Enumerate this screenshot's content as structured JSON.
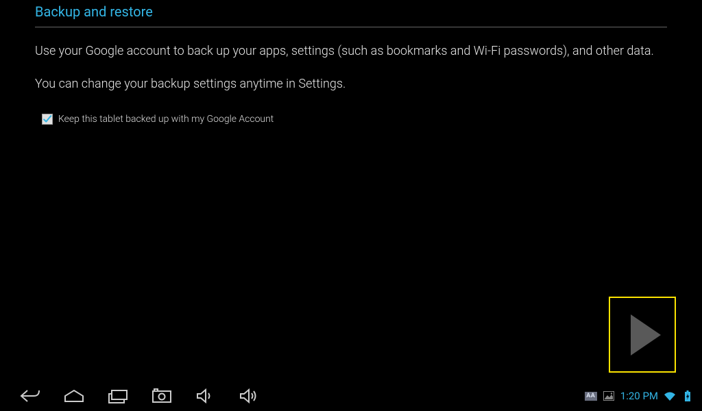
{
  "title": "Backup and restore",
  "description": {
    "line1": "Use your Google account to back up your apps, settings (such as bookmarks and Wi-Fi passwords), and other data.",
    "line2": "You can change your backup settings anytime in Settings."
  },
  "checkbox": {
    "label": "Keep this tablet backed up with my Google Account",
    "checked": true
  },
  "statusbar": {
    "aa": "AA",
    "time": "1:20 PM"
  },
  "colors": {
    "accent": "#33b5e5",
    "highlight": "#fce300"
  }
}
